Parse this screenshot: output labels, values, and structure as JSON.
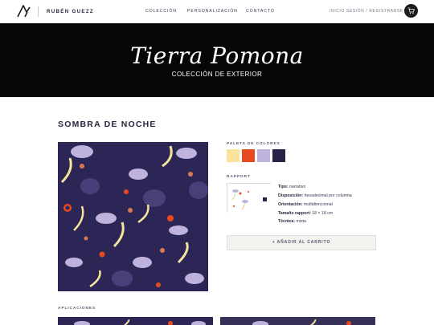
{
  "nav": {
    "brand": "RUBÉN GUEZZ",
    "menu": [
      "COLECCIÓN",
      "PERSONALIZACIÓN",
      "CONTACTO"
    ],
    "login": "INICIO SESIÓN / REGISTRARSE",
    "cart_icon": "shopping-cart-icon",
    "logo_icon": "rg-logo-icon"
  },
  "hero": {
    "title": "Tierra Pomona",
    "subtitle": "COLECCIÓN DE EXTERIOR"
  },
  "product": {
    "title": "SOMBRA DE NOCHE",
    "palette_label": "PALETA DE COLORES",
    "palette": [
      "#f7e39c",
      "#e8491e",
      "#bfb3de",
      "#272248"
    ],
    "rapport_label": "RAPPORT",
    "specs": [
      {
        "key": "Tipo:",
        "value": " narrativo"
      },
      {
        "key": "Disposición:",
        "value": " hexadecimal por columna"
      },
      {
        "key": "Orientación:",
        "value": " multidireccional"
      },
      {
        "key": "Tamaño rapport:",
        "value": " 18 × 18 cm"
      },
      {
        "key": "Técnica:",
        "value": " mixta"
      }
    ],
    "add_to_cart": "+ AÑADIR AL CARRITO"
  },
  "applications": {
    "label": "APLICACIONES"
  },
  "colors": {
    "pattern_bg": "#2b2656",
    "hero_bg": "#060606",
    "text": "#2a2540"
  }
}
